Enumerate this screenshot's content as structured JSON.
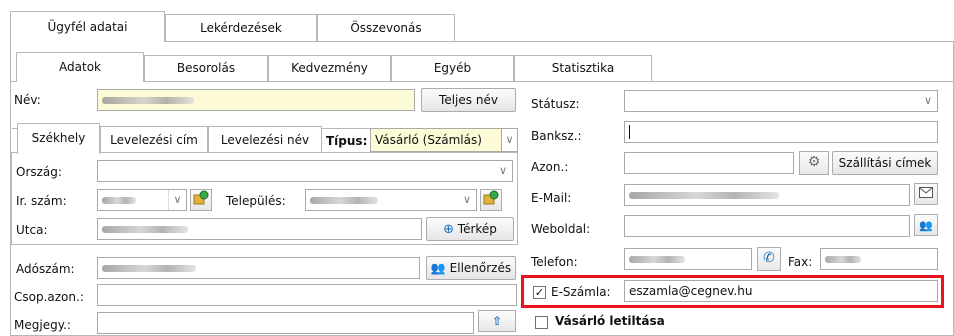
{
  "top_tabs": [
    "Ügyfél adatai",
    "Lekérdezések",
    "Összevonás"
  ],
  "sub_tabs": [
    "Adatok",
    "Besorolás",
    "Kedvezmény",
    "Egyéb",
    "Statisztika"
  ],
  "address_tabs": [
    "Székhely",
    "Levelezési cím",
    "Levelezési név"
  ],
  "labels": {
    "nev": "Név:",
    "tipus": "Típus:",
    "orszag": "Ország:",
    "irszam": "Ir. szám:",
    "telepules": "Település:",
    "utca": "Utca:",
    "adoszam": "Adószám:",
    "csop": "Csop.azon.:",
    "megjegy": "Megjegy.:",
    "statusz": "Státusz:",
    "banksz": "Banksz.:",
    "azon": "Azon.:",
    "email": "E-Mail:",
    "weboldal": "Weboldal:",
    "telefon": "Telefon:",
    "fax": "Fax:",
    "eszamla": "E-Számla:",
    "vasarlo_letiltasa": "Vásárló letiltása"
  },
  "buttons": {
    "teljes_nev": "Teljes név",
    "terkep": "Térkép",
    "ellenorzes": "Ellenőrzés",
    "szallitasi_cimek": "Szállítási címek"
  },
  "values": {
    "tipus": "Vásárló (Számlás)",
    "eszamla_email": "eszamla@cegnev.hu"
  },
  "state": {
    "eszamla_checked": true,
    "vasarlo_letiltasa_checked": false
  },
  "icons": {
    "dropdown": "chevron-down-icon",
    "pin": "map-pin-icon",
    "gear": "gear-icon",
    "mail": "mail-icon",
    "globe": "globe-icon",
    "phone": "phone-icon",
    "people": "people-icon",
    "up": "arrow-up-icon"
  },
  "colors": {
    "highlight_border": "#e8141b",
    "name_field_bg": "#fdfbd5"
  }
}
